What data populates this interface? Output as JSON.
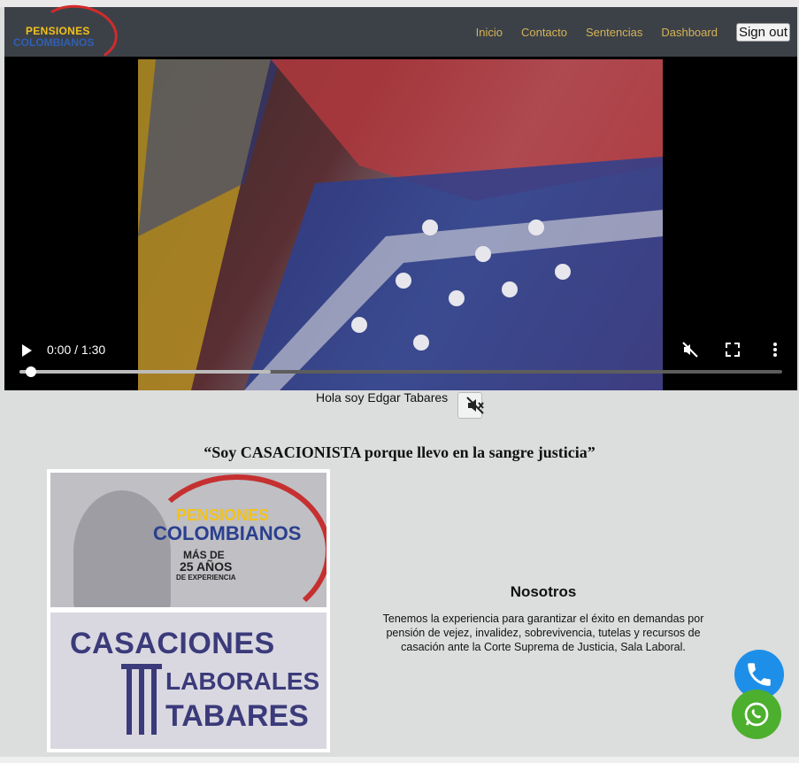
{
  "brand": {
    "line1": "PENSIONES",
    "line2": "COLOMBIANOS"
  },
  "nav": {
    "links": [
      "Inicio",
      "Contacto",
      "Sentencias",
      "Dashboard"
    ],
    "signout_label": "Sign out"
  },
  "video": {
    "time": "0:00 / 1:30",
    "play_icon": "play-icon",
    "muted_icon": "volume-muted-icon",
    "fullscreen_icon": "fullscreen-icon",
    "more_icon": "more-vertical-icon",
    "buffered_fraction": 0.33,
    "played_fraction": 0.0
  },
  "caption": "Hola soy Edgar Tabares",
  "quote": "“Soy CASACIONISTA porque llevo en la sangre justicia”",
  "promo_image": {
    "top": {
      "t1": "PENSIONES",
      "t2": "COLOMBIANOS",
      "t3": "MÁS DE",
      "t4": "25 AÑOS",
      "t5": "DE EXPERIENCIA"
    },
    "bottom": {
      "b1": "CASACIONES",
      "b2": "LABORALES",
      "b3": "TABARES"
    }
  },
  "about": {
    "title": "Nosotros",
    "text": "Tenemos la experiencia para garantizar el éxito en demandas por pensión de vejez, invalidez, sobrevivencia, tutelas y recursos de casación ante la Corte Suprema de Justicia, Sala Laboral."
  },
  "fabs": {
    "phone_icon": "phone-icon",
    "whatsapp_icon": "whatsapp-icon"
  },
  "colors": {
    "navbar": "#3c4148",
    "nav_link": "#d5b455",
    "phone": "#1e8fe8",
    "whatsapp": "#4caf2e"
  }
}
